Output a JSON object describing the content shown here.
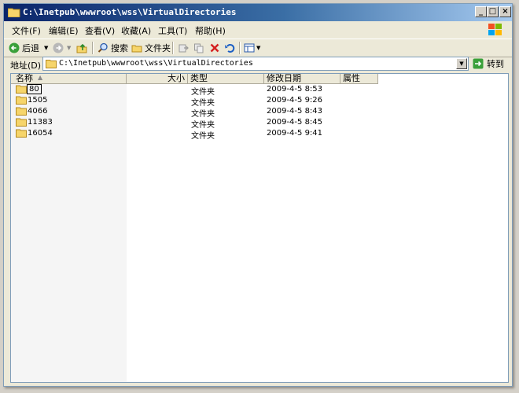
{
  "window": {
    "title": "C:\\Inetpub\\wwwroot\\wss\\VirtualDirectories"
  },
  "menu": [
    {
      "label": "文件(F)"
    },
    {
      "label": "编辑(E)"
    },
    {
      "label": "查看(V)"
    },
    {
      "label": "收藏(A)"
    },
    {
      "label": "工具(T)"
    },
    {
      "label": "帮助(H)"
    }
  ],
  "toolbar": {
    "back_label": "后退",
    "search_label": "搜索",
    "folders_label": "文件夹"
  },
  "address": {
    "label": "地址(D)",
    "value": "C:\\Inetpub\\wwwroot\\wss\\VirtualDirectories",
    "go_label": "转到"
  },
  "columns": {
    "name": "名称",
    "size": "大小",
    "type": "类型",
    "modified": "修改日期",
    "attributes": "属性"
  },
  "rows": [
    {
      "name": "80",
      "type": "文件夹",
      "modified": "2009-4-5 8:53"
    },
    {
      "name": "1505",
      "type": "文件夹",
      "modified": "2009-4-5 9:26"
    },
    {
      "name": "4066",
      "type": "文件夹",
      "modified": "2009-4-5 8:43"
    },
    {
      "name": "11383",
      "type": "文件夹",
      "modified": "2009-4-5 8:45"
    },
    {
      "name": "16054",
      "type": "文件夹",
      "modified": "2009-4-5 9:41"
    }
  ]
}
